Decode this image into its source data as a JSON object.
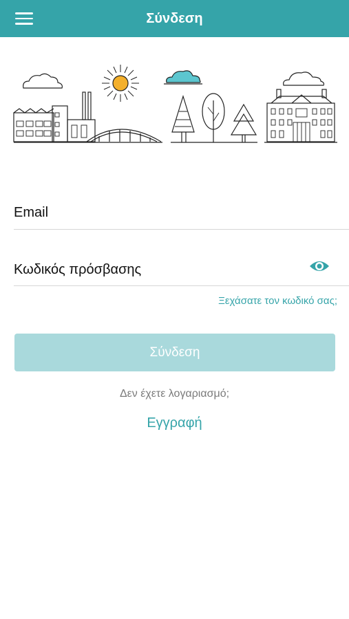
{
  "header": {
    "title": "Σύνδεση",
    "menu_icon": "menu-icon",
    "background_color": "#35a4a9"
  },
  "illustration": {
    "description_icon": "city-nature-illustration"
  },
  "form": {
    "email_label": "Email",
    "password_label": "Κωδικός πρόσβασης",
    "show_password_icon": "eye-icon",
    "forgot_password": "Ξεχάσατε τον κωδικό σας;"
  },
  "actions": {
    "login_label": "Σύνδεση",
    "login_color": "#a9d9dc",
    "no_account_text": "Δεν έχετε λογαριασμό;",
    "register_label": "Εγγραφή"
  },
  "colors": {
    "accent": "#35a4a9",
    "sun": "#f4b02c"
  }
}
